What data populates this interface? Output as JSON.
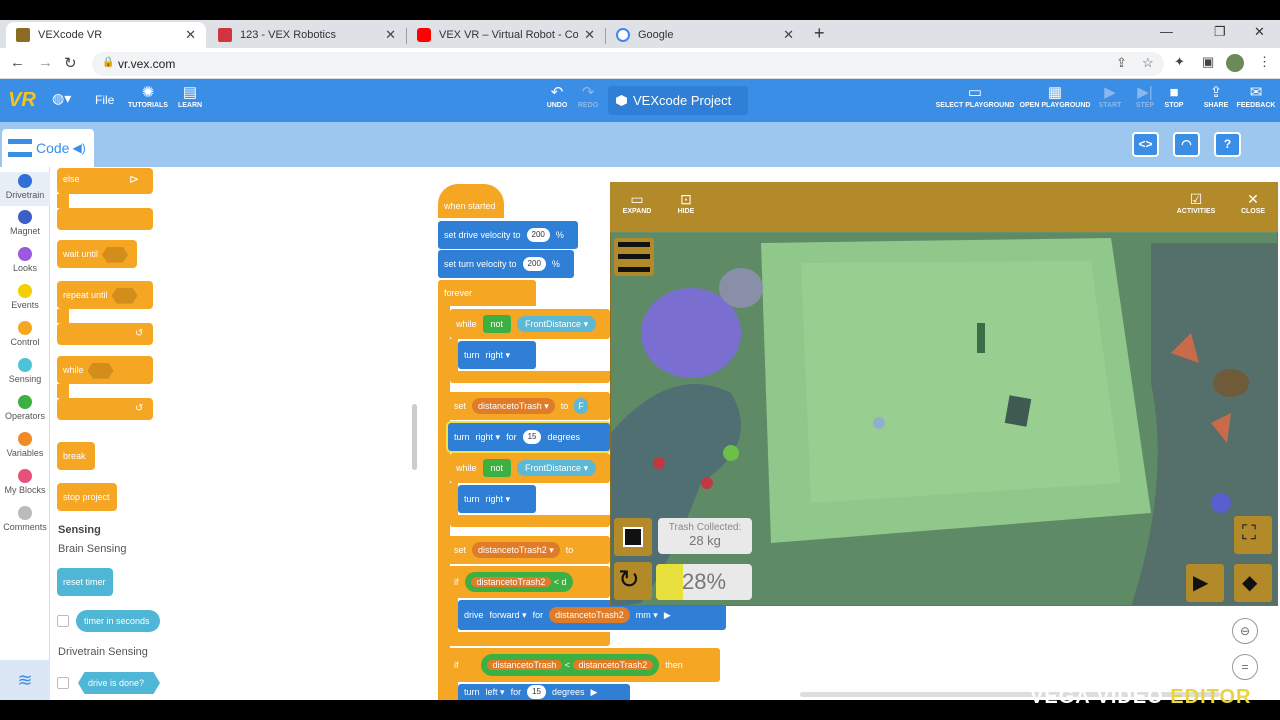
{
  "browser": {
    "tabs": [
      {
        "title": "VEXcode VR"
      },
      {
        "title": "123 - VEX Robotics"
      },
      {
        "title": "VEX VR – Virtual Robot - Coral Re"
      },
      {
        "title": "Google"
      }
    ],
    "url": "vr.vex.com"
  },
  "toolbar": {
    "logo": "VR",
    "file": "File",
    "tutorials": "TUTORIALS",
    "learn": "LEARN",
    "undo": "UNDO",
    "redo": "REDO",
    "project_name": "VEXcode Project",
    "select_playground": "SELECT PLAYGROUND",
    "open_playground": "OPEN PLAYGROUND",
    "start": "START",
    "step": "STEP",
    "stop": "STOP",
    "share": "SHARE",
    "feedback": "FEEDBACK"
  },
  "code_tab": "Code",
  "categories": [
    "Drivetrain",
    "Magnet",
    "Looks",
    "Events",
    "Control",
    "Sensing",
    "Operators",
    "Variables",
    "My Blocks",
    "Comments"
  ],
  "category_colors": [
    "#2f6fd6",
    "#3b5fc4",
    "#9b59e0",
    "#f5d000",
    "#f5a623",
    "#4fc3d6",
    "#3cb043",
    "#f08a24",
    "#e8507a",
    "#bbbbbb"
  ],
  "flyout": {
    "else": "else",
    "wait_until": "wait until",
    "repeat_until": "repeat until",
    "while": "while",
    "break": "break",
    "stop_project": "stop project",
    "sensing_header": "Sensing",
    "brain_sensing": "Brain Sensing",
    "reset_timer": "reset timer",
    "timer_in_seconds": "timer in seconds",
    "drivetrain_sensing": "Drivetrain Sensing",
    "drive_is_done": "drive is done?"
  },
  "script": {
    "when_started": "when started",
    "set_drive_velocity": "set drive velocity to",
    "drive_velocity": "200",
    "set_turn_velocity": "set turn velocity to",
    "turn_velocity": "200",
    "percent": "%",
    "forever": "forever",
    "while": "while",
    "not": "not",
    "front_distance": "FrontDistance",
    "turn": "turn",
    "right": "right",
    "set": "set",
    "distance_to_trash": "distancetoTrash",
    "to": "to",
    "for": "for",
    "degrees": "degrees",
    "deg_15": "15",
    "distance_to_trash2": "distancetoTrash2",
    "if": "if",
    "lt": "<",
    "drive": "drive",
    "forward": "forward",
    "mm": "mm",
    "then": "then",
    "left": "left",
    "truncated_f": "F",
    "truncated_d": "d"
  },
  "playground": {
    "expand": "EXPAND",
    "hide": "HIDE",
    "activities": "ACTIVITIES",
    "close": "CLOSE",
    "trash_label": "Trash Collected:",
    "trash_value": "28 kg",
    "battery_label": "28%",
    "battery_level": 0.28
  },
  "watermark": {
    "part1": "VEGA VIDEO ",
    "part2": "EDITOR"
  }
}
